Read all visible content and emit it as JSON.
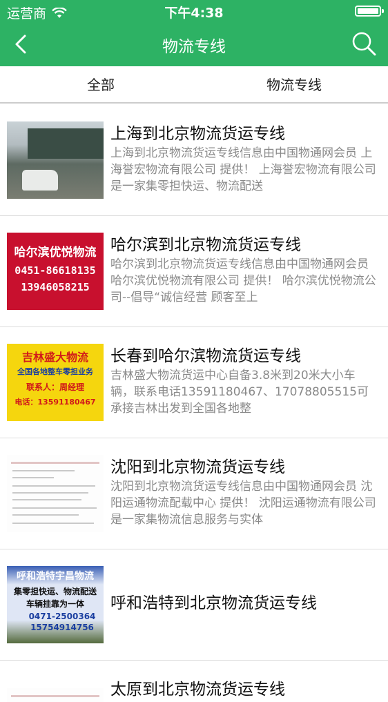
{
  "status_bar": {
    "carrier": "运营商",
    "time": "下午4:38"
  },
  "nav": {
    "title": "物流专线"
  },
  "tabs": [
    "全部",
    "物流专线"
  ],
  "items": [
    {
      "title": "上海到北京物流货运专线",
      "desc": "上海到北京物流货运专线信息由中国物通网会员 上海誉宏物流有限公司 提供！ 上海誉宏物流有限公司是一家集零担快运、物流配送",
      "thumb": "warehouse-photo"
    },
    {
      "title": "哈尔滨到北京物流货运专线",
      "desc": "哈尔滨到北京物流货运专线信息由中国物通网会员 哈尔滨优悦物流有限公司 提供！ 哈尔滨优悦物流公司--倡导“诚信经营 顾客至上",
      "thumb": "red-banner",
      "thumb_lines": [
        "哈尔滨优悦物流",
        "0451-86618135",
        "13946058215"
      ]
    },
    {
      "title": "长春到哈尔滨物流货运专线",
      "desc": "吉林盛大物流货运中心自备3.8米到20米大小车辆，联系电话13591180467、17078805515可承接吉林出发到全国各地整",
      "thumb": "yellow-banner",
      "thumb_lines": [
        "吉林盛大物流",
        "全国各地整车零担业务",
        "联系人：周经理",
        "电话：13591180467"
      ]
    },
    {
      "title": "沈阳到北京物流货运专线",
      "desc": "沈阳到北京物流货运专线信息由中国物通网会员 沈阳运通物流配载中心 提供！ 沈阳运通物流有限公司是一家集物流信息服务与实体",
      "thumb": "document-screenshot"
    },
    {
      "title": "呼和浩特到北京物流货运专线",
      "desc": "",
      "thumb": "blue-banner",
      "thumb_lines": [
        "呼和浩特宇昌物流",
        "集零担快运、物流配送",
        "车辆挂靠为一体",
        "0471-2500364",
        "15754914756"
      ]
    },
    {
      "title": "太原到北京物流货运专线",
      "desc": "",
      "thumb": "document-screenshot"
    }
  ],
  "colors": {
    "primary": "#2db264",
    "title_text": "#111111",
    "desc_text": "#8a8a8a"
  }
}
